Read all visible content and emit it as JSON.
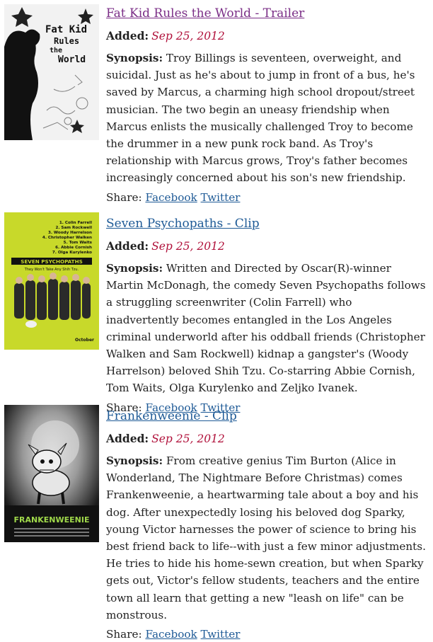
{
  "movies": [
    {
      "title": "Fat Kid Rules the World - Trailer",
      "added_label": "Added:",
      "date": "Sep 25, 2012",
      "synopsis_label": "Synopsis:",
      "synopsis": "Troy Billings is seventeen, overweight, and suicidal. Just as he's about to jump in front of a bus, he's saved by Marcus, a charming high school dropout/street musician. The two begin an uneasy friendship when Marcus enlists the musically challenged Troy to become the drummer in a new punk rock band. As Troy's relationship with Marcus grows, Troy's father becomes increasingly concerned about his son's new friendship.",
      "share_label": "Share:",
      "facebook": "Facebook",
      "twitter": "Twitter",
      "poster_text": [
        "Fat Kid",
        "Rules",
        "the",
        "World"
      ]
    },
    {
      "title": "Seven Psychopaths - Clip",
      "added_label": "Added:",
      "date": "Sep 25, 2012",
      "synopsis_label": "Synopsis:",
      "synopsis": "Written and Directed by Oscar(R)-winner Martin McDonagh, the comedy Seven Psychopaths follows a struggling screenwriter (Colin Farrell) who inadvertently becomes entangled in the Los Angeles criminal underworld after his oddball friends (Christopher Walken and Sam Rockwell) kidnap a gangster's (Woody Harrelson) beloved Shih Tzu. Co-starring Abbie Cornish, Tom Waits, Olga Kurylenko and Zeljko Ivanek.",
      "share_label": "Share:",
      "facebook": "Facebook",
      "twitter": "Twitter",
      "poster_cast": [
        "1. Colin Farrell",
        "2. Sam Rockwell",
        "3. Woody Harrelson",
        "4. Christopher Walken",
        "5. Tom Waits",
        "6. Abbie Cornish",
        "7. Olga Kurylenko"
      ],
      "poster_title": "SEVEN PSYCHOPATHS",
      "poster_tagline": "They Won't Take Any Shih Tzu.",
      "poster_date": "October"
    },
    {
      "title": "Frankenweenie - Clip",
      "added_label": "Added:",
      "date": "Sep 25, 2012",
      "synopsis_label": "Synopsis:",
      "synopsis": "From creative genius Tim Burton (Alice in Wonderland, The Nightmare Before Christmas) comes Frankenweenie, a heartwarming tale about a boy and his dog. After unexpectedly losing his beloved dog Sparky, young Victor harnesses the power of science to bring his best friend back to life--with just a few minor adjustments. He tries to hide his home-sewn creation, but when Sparky gets out, Victor's fellow students, teachers and the entire town all learn that getting a new \"leash on life\" can be monstrous.",
      "share_label": "Share:",
      "facebook": "Facebook",
      "twitter": "Twitter",
      "poster_title": "FRANKENWEENIE"
    }
  ],
  "colors": {
    "visited_link": "#7a2d86",
    "link": "#1e5a96",
    "date": "#b0103a",
    "psychopaths_bg": "#c8d92a"
  }
}
